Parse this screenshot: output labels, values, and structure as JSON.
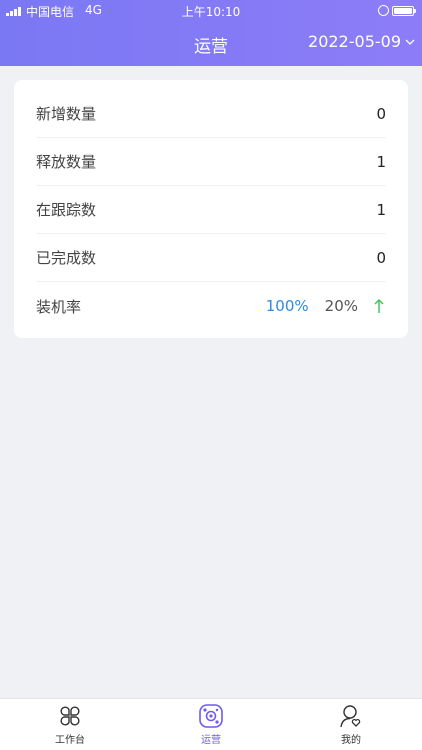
{
  "status_bar": {
    "carrier": "中国电信",
    "network": "4G",
    "time": "上午10:10",
    "battery_level": 1.0
  },
  "header": {
    "title": "运营",
    "date": "2022-05-09"
  },
  "stats": {
    "new_count_label": "新增数量",
    "new_count_value": "0",
    "release_count_label": "释放数量",
    "release_count_value": "1",
    "tracking_count_label": "在跟踪数",
    "tracking_count_value": "1",
    "completed_count_label": "已完成数",
    "completed_count_value": "0",
    "install_rate_label": "装机率",
    "install_rate_primary": "100%",
    "install_rate_secondary": "20%"
  },
  "tabbar": {
    "workbench_label": "工作台",
    "operations_label": "运营",
    "mine_label": "我的"
  },
  "colors": {
    "header_bg": "#7b78f4",
    "accent": "#6c5cf0",
    "rate_blue": "#2f8ae0",
    "trend_up": "#3cc05a"
  },
  "icons": {
    "date_dropdown": "chevron-down-icon",
    "trend": "arrow-up-icon",
    "workbench": "workbench-grid-icon",
    "operations": "operations-icon",
    "mine": "user-heart-icon"
  }
}
